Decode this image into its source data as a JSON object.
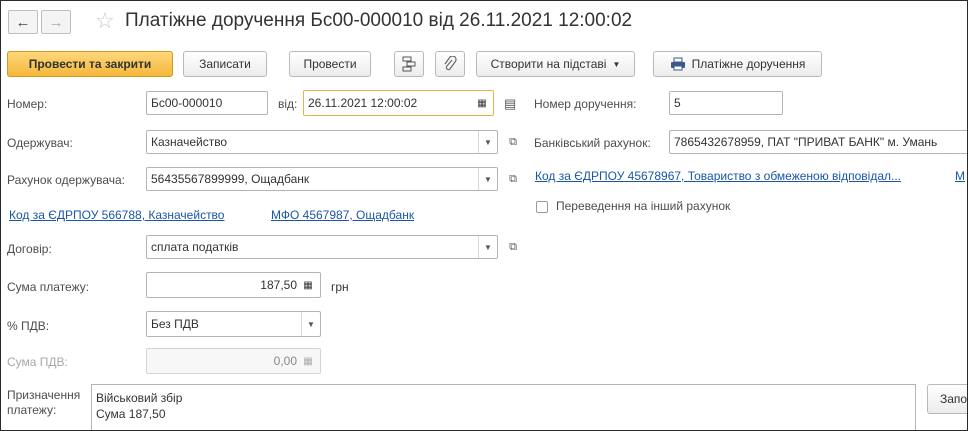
{
  "header": {
    "back_icon": "arrow-left-icon",
    "forward_icon": "arrow-right-icon",
    "favorite_icon": "star-outline-icon",
    "title": "Платіжне доручення Бс00-000010 від 26.11.2021 12:00:02"
  },
  "toolbar": {
    "post_close": "Провести та закрити",
    "write": "Записати",
    "post": "Провести",
    "structure_icon": "structure-icon",
    "attach_icon": "paperclip-icon",
    "create_based": "Створити на підставі",
    "print_icon": "printer-icon",
    "print": "Платіжне доручення"
  },
  "form": {
    "number_label": "Номер:",
    "number_value": "Бс00-000010",
    "date_label": "від:",
    "date_value": "26.11.2021 12:00:02",
    "order_number_label": "Номер доручення:",
    "order_number_value": "5",
    "recipient_label": "Одержувач:",
    "recipient_value": "Казначейство",
    "bank_account_label": "Банківський рахунок:",
    "bank_account_value": "7865432678959, ПАТ \"ПРИВАТ БАНК\" м. Умань",
    "recipient_account_label": "Рахунок одержувача:",
    "recipient_account_value": "56435567899999, Ощадбанк",
    "org_code_link": "Код за ЄДРПОУ 45678967, Товариство з обмеженою відповідал...",
    "org_mfo_link": "М",
    "recipient_code_link": "Код за ЄДРПОУ 566788, Казначейство",
    "recipient_mfo_link": "МФО 4567987, Ощадбанк",
    "transfer_label": "Переведення на інший рахунок",
    "contract_label": "Договір:",
    "contract_value": "сплата податків",
    "amount_label": "Сума платежу:",
    "amount_value": "187,50",
    "currency": "грн",
    "vat_rate_label": "% ПДВ:",
    "vat_rate_value": "Без ПДВ",
    "vat_amount_label": "Сума ПДВ:",
    "vat_amount_value": "0,00",
    "purpose_label_1": "Призначення",
    "purpose_label_2": "платежу:",
    "purpose_line_1": "Військовий збір",
    "purpose_line_2": "Сума 187,50",
    "fill_button": "Запо"
  }
}
